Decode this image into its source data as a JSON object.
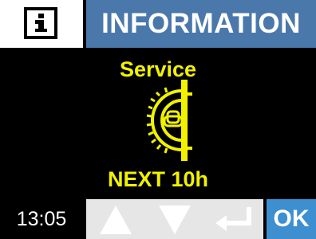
{
  "header": {
    "info_icon": "info-icon",
    "title": "INFORMATION",
    "title_bg": "#4b78ab"
  },
  "main": {
    "service_label": "Service",
    "service_icon": "service-wheel-icon",
    "next_service": "NEXT 10h",
    "accent": "#f2f200"
  },
  "footer": {
    "time": "13:05",
    "up_icon": "arrow-up-icon",
    "down_icon": "arrow-down-icon",
    "enter_icon": "enter-icon",
    "ok_label": "OK",
    "ok_bg": "#3d8fd0"
  }
}
